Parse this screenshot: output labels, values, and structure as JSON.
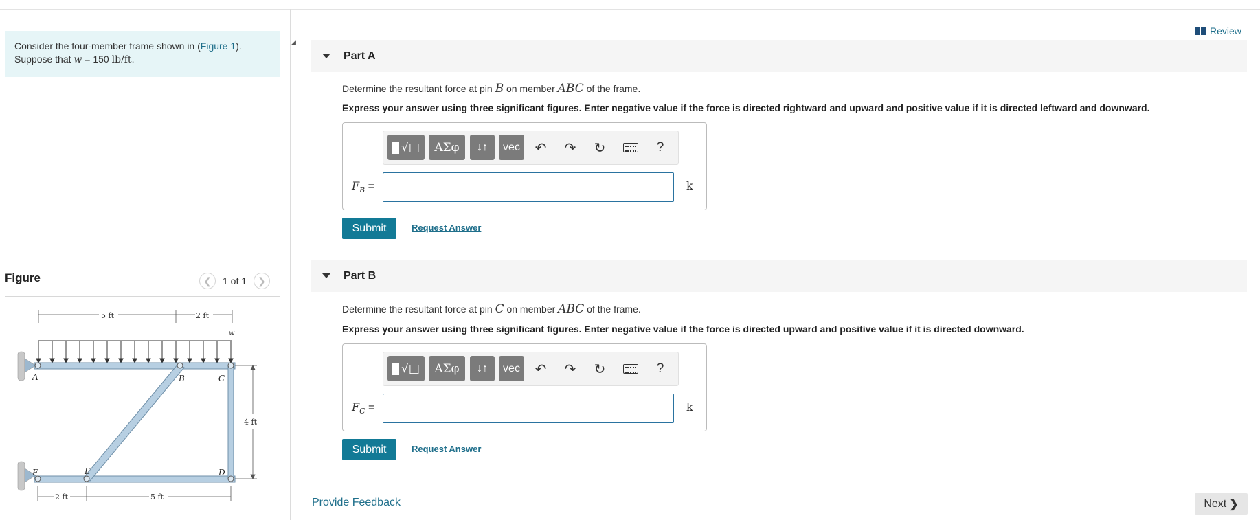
{
  "intro": {
    "line1_prefix": "Consider the four-member frame shown in (",
    "figure_link": "Figure 1",
    "line1_suffix": ").",
    "line2_prefix": "Suppose that ",
    "var_w": "w",
    "equals_value": " = 150 ",
    "unit": "lb/ft",
    "line2_suffix": "."
  },
  "figure": {
    "title": "Figure",
    "prev_icon": "chevron-left-icon",
    "next_icon": "chevron-right-icon",
    "pager_text": "1 of 1",
    "labels": {
      "dim_top_left": "5 ft",
      "dim_top_right": "2 ft",
      "load": "w",
      "A": "A",
      "B": "B",
      "C": "C",
      "D": "D",
      "E": "E",
      "F": "F",
      "dim_right": "4 ft",
      "dim_bottom_left": "2 ft",
      "dim_bottom_right": "5 ft"
    }
  },
  "header": {
    "review_label": "Review",
    "review_icon": "book-icon"
  },
  "parts": [
    {
      "title": "Part A",
      "question_prefix": "Determine the resultant force at pin ",
      "pin": "B",
      "question_mid": " on member ",
      "member": "ABC",
      "question_suffix": " of the frame.",
      "instruction": "Express your answer using three significant figures. Enter negative value if the force is directed rightward and upward and positive value if it is directed leftward and downward.",
      "var": "F",
      "var_sub": "B",
      "equals": " =",
      "unit": "k",
      "submit_label": "Submit",
      "request_label": "Request Answer"
    },
    {
      "title": "Part B",
      "question_prefix": "Determine the resultant force at pin ",
      "pin": "C",
      "question_mid": " on member ",
      "member": "ABC",
      "question_suffix": " of the frame.",
      "instruction": "Express your answer using three significant figures. Enter negative value if the force is directed upward and positive value if it is directed downward.",
      "var": "F",
      "var_sub": "C",
      "equals": " =",
      "unit": "k",
      "submit_label": "Submit",
      "request_label": "Request Answer"
    }
  ],
  "toolbar": {
    "templates_icon": "templates-icon",
    "greek_label": "ΑΣφ",
    "arrows_label": "↓↑",
    "vec_label": "vec",
    "undo_icon": "undo-icon",
    "redo_icon": "redo-icon",
    "reset_icon": "reset-icon",
    "keyboard_icon": "keyboard-icon",
    "help_label": "?"
  },
  "footer": {
    "feedback_label": "Provide Feedback",
    "next_label": "Next",
    "next_icon": "chevron-right-icon"
  },
  "colors": {
    "accent": "#127a96",
    "link": "#1f6f8b",
    "intro_bg": "#e6f5f7"
  }
}
